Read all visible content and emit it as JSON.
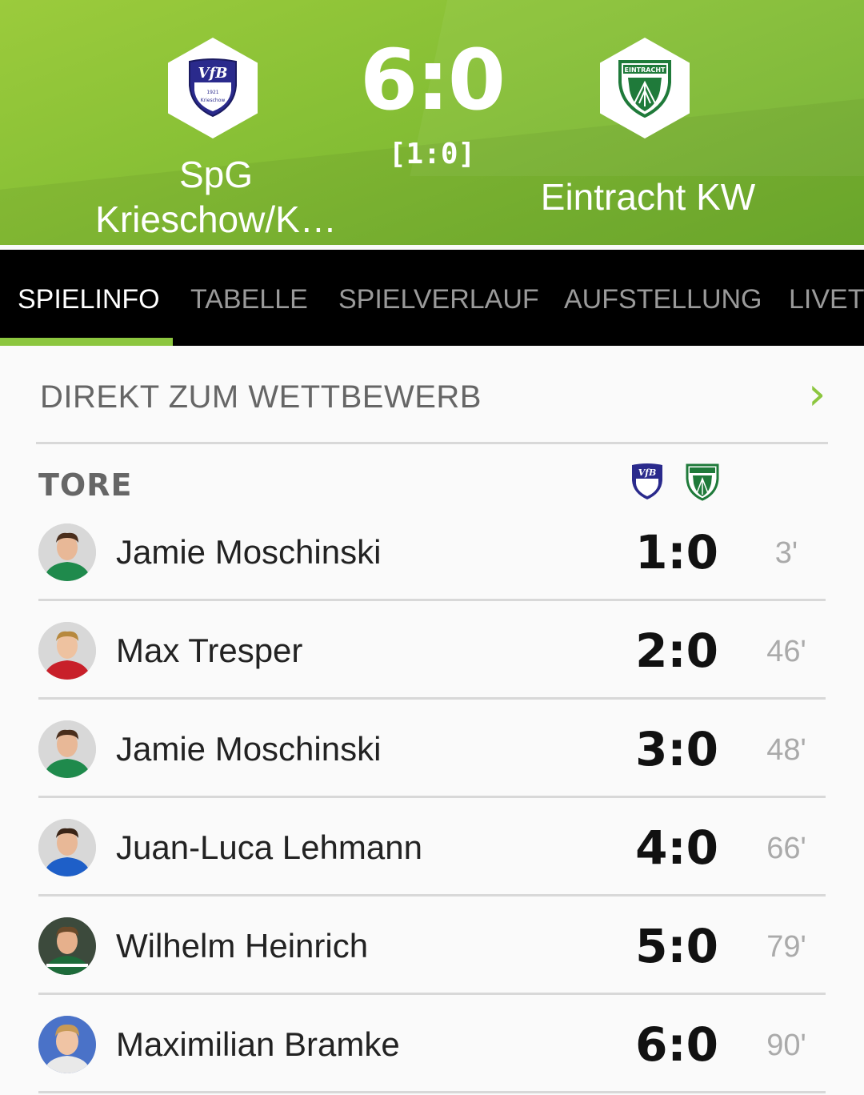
{
  "match": {
    "home_team": "SpG\nKrieschow/K…",
    "away_team": "Eintracht KW",
    "score": "6:0",
    "halftime": "[1:0]",
    "home_crest_text": "VfB",
    "home_crest_year": "1921",
    "home_crest_city": "Krieschow",
    "away_crest_text": "EINTRACHT"
  },
  "tabs": [
    {
      "label": "SPIELINFO",
      "active": true
    },
    {
      "label": "TABELLE",
      "active": false
    },
    {
      "label": "SPIELVERLAUF",
      "active": false
    },
    {
      "label": "AUFSTELLUNG",
      "active": false
    },
    {
      "label": "LIVET",
      "active": false
    }
  ],
  "competition_link": {
    "label": "DIREKT ZUM WETTBEWERB",
    "icon": "chevron-right-icon"
  },
  "goals": {
    "title": "TORE",
    "items": [
      {
        "player": "Jamie Moschinski",
        "score": "1:0",
        "minute": "3'",
        "shirt": "#1f8a4c"
      },
      {
        "player": "Max Tresper",
        "score": "2:0",
        "minute": "46'",
        "shirt": "#c8202a"
      },
      {
        "player": "Jamie Moschinski",
        "score": "3:0",
        "minute": "48'",
        "shirt": "#1f8a4c"
      },
      {
        "player": "Juan-Luca Lehmann",
        "score": "4:0",
        "minute": "66'",
        "shirt": "#1e5fc8"
      },
      {
        "player": "Wilhelm Heinrich",
        "score": "5:0",
        "minute": "79'",
        "shirt": "#1d6b3a"
      },
      {
        "player": "Maximilian Bramke",
        "score": "6:0",
        "minute": "90'",
        "shirt": "#4a72c8"
      }
    ]
  },
  "colors": {
    "accent": "#8cc63f",
    "header_green": "#86bf35",
    "home_navy": "#2a2a8c",
    "away_green": "#1f7a3a"
  }
}
